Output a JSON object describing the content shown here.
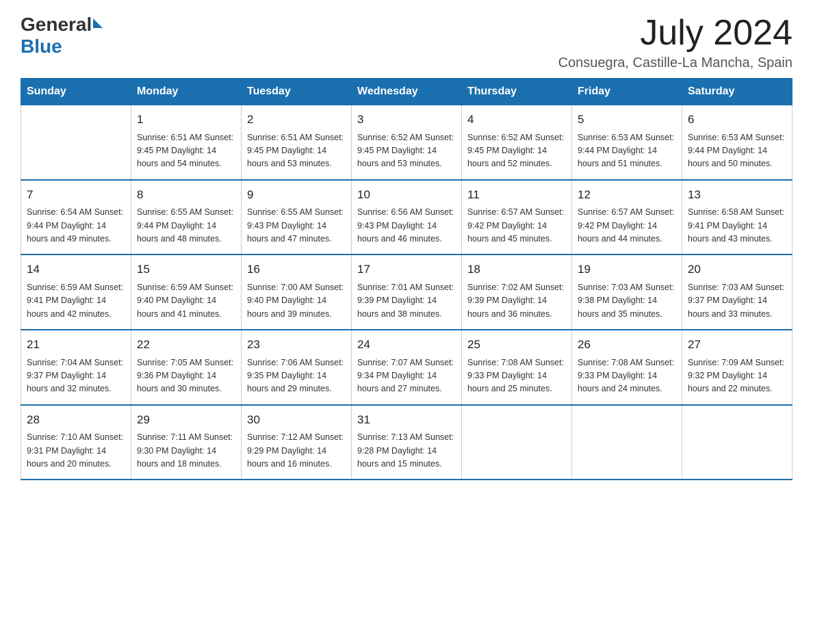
{
  "logo": {
    "general": "General",
    "blue": "Blue"
  },
  "title": {
    "month_year": "July 2024",
    "location": "Consuegra, Castille-La Mancha, Spain"
  },
  "days_of_week": [
    "Sunday",
    "Monday",
    "Tuesday",
    "Wednesday",
    "Thursday",
    "Friday",
    "Saturday"
  ],
  "weeks": [
    [
      {
        "day": "",
        "info": ""
      },
      {
        "day": "1",
        "info": "Sunrise: 6:51 AM\nSunset: 9:45 PM\nDaylight: 14 hours\nand 54 minutes."
      },
      {
        "day": "2",
        "info": "Sunrise: 6:51 AM\nSunset: 9:45 PM\nDaylight: 14 hours\nand 53 minutes."
      },
      {
        "day": "3",
        "info": "Sunrise: 6:52 AM\nSunset: 9:45 PM\nDaylight: 14 hours\nand 53 minutes."
      },
      {
        "day": "4",
        "info": "Sunrise: 6:52 AM\nSunset: 9:45 PM\nDaylight: 14 hours\nand 52 minutes."
      },
      {
        "day": "5",
        "info": "Sunrise: 6:53 AM\nSunset: 9:44 PM\nDaylight: 14 hours\nand 51 minutes."
      },
      {
        "day": "6",
        "info": "Sunrise: 6:53 AM\nSunset: 9:44 PM\nDaylight: 14 hours\nand 50 minutes."
      }
    ],
    [
      {
        "day": "7",
        "info": "Sunrise: 6:54 AM\nSunset: 9:44 PM\nDaylight: 14 hours\nand 49 minutes."
      },
      {
        "day": "8",
        "info": "Sunrise: 6:55 AM\nSunset: 9:44 PM\nDaylight: 14 hours\nand 48 minutes."
      },
      {
        "day": "9",
        "info": "Sunrise: 6:55 AM\nSunset: 9:43 PM\nDaylight: 14 hours\nand 47 minutes."
      },
      {
        "day": "10",
        "info": "Sunrise: 6:56 AM\nSunset: 9:43 PM\nDaylight: 14 hours\nand 46 minutes."
      },
      {
        "day": "11",
        "info": "Sunrise: 6:57 AM\nSunset: 9:42 PM\nDaylight: 14 hours\nand 45 minutes."
      },
      {
        "day": "12",
        "info": "Sunrise: 6:57 AM\nSunset: 9:42 PM\nDaylight: 14 hours\nand 44 minutes."
      },
      {
        "day": "13",
        "info": "Sunrise: 6:58 AM\nSunset: 9:41 PM\nDaylight: 14 hours\nand 43 minutes."
      }
    ],
    [
      {
        "day": "14",
        "info": "Sunrise: 6:59 AM\nSunset: 9:41 PM\nDaylight: 14 hours\nand 42 minutes."
      },
      {
        "day": "15",
        "info": "Sunrise: 6:59 AM\nSunset: 9:40 PM\nDaylight: 14 hours\nand 41 minutes."
      },
      {
        "day": "16",
        "info": "Sunrise: 7:00 AM\nSunset: 9:40 PM\nDaylight: 14 hours\nand 39 minutes."
      },
      {
        "day": "17",
        "info": "Sunrise: 7:01 AM\nSunset: 9:39 PM\nDaylight: 14 hours\nand 38 minutes."
      },
      {
        "day": "18",
        "info": "Sunrise: 7:02 AM\nSunset: 9:39 PM\nDaylight: 14 hours\nand 36 minutes."
      },
      {
        "day": "19",
        "info": "Sunrise: 7:03 AM\nSunset: 9:38 PM\nDaylight: 14 hours\nand 35 minutes."
      },
      {
        "day": "20",
        "info": "Sunrise: 7:03 AM\nSunset: 9:37 PM\nDaylight: 14 hours\nand 33 minutes."
      }
    ],
    [
      {
        "day": "21",
        "info": "Sunrise: 7:04 AM\nSunset: 9:37 PM\nDaylight: 14 hours\nand 32 minutes."
      },
      {
        "day": "22",
        "info": "Sunrise: 7:05 AM\nSunset: 9:36 PM\nDaylight: 14 hours\nand 30 minutes."
      },
      {
        "day": "23",
        "info": "Sunrise: 7:06 AM\nSunset: 9:35 PM\nDaylight: 14 hours\nand 29 minutes."
      },
      {
        "day": "24",
        "info": "Sunrise: 7:07 AM\nSunset: 9:34 PM\nDaylight: 14 hours\nand 27 minutes."
      },
      {
        "day": "25",
        "info": "Sunrise: 7:08 AM\nSunset: 9:33 PM\nDaylight: 14 hours\nand 25 minutes."
      },
      {
        "day": "26",
        "info": "Sunrise: 7:08 AM\nSunset: 9:33 PM\nDaylight: 14 hours\nand 24 minutes."
      },
      {
        "day": "27",
        "info": "Sunrise: 7:09 AM\nSunset: 9:32 PM\nDaylight: 14 hours\nand 22 minutes."
      }
    ],
    [
      {
        "day": "28",
        "info": "Sunrise: 7:10 AM\nSunset: 9:31 PM\nDaylight: 14 hours\nand 20 minutes."
      },
      {
        "day": "29",
        "info": "Sunrise: 7:11 AM\nSunset: 9:30 PM\nDaylight: 14 hours\nand 18 minutes."
      },
      {
        "day": "30",
        "info": "Sunrise: 7:12 AM\nSunset: 9:29 PM\nDaylight: 14 hours\nand 16 minutes."
      },
      {
        "day": "31",
        "info": "Sunrise: 7:13 AM\nSunset: 9:28 PM\nDaylight: 14 hours\nand 15 minutes."
      },
      {
        "day": "",
        "info": ""
      },
      {
        "day": "",
        "info": ""
      },
      {
        "day": "",
        "info": ""
      }
    ]
  ]
}
